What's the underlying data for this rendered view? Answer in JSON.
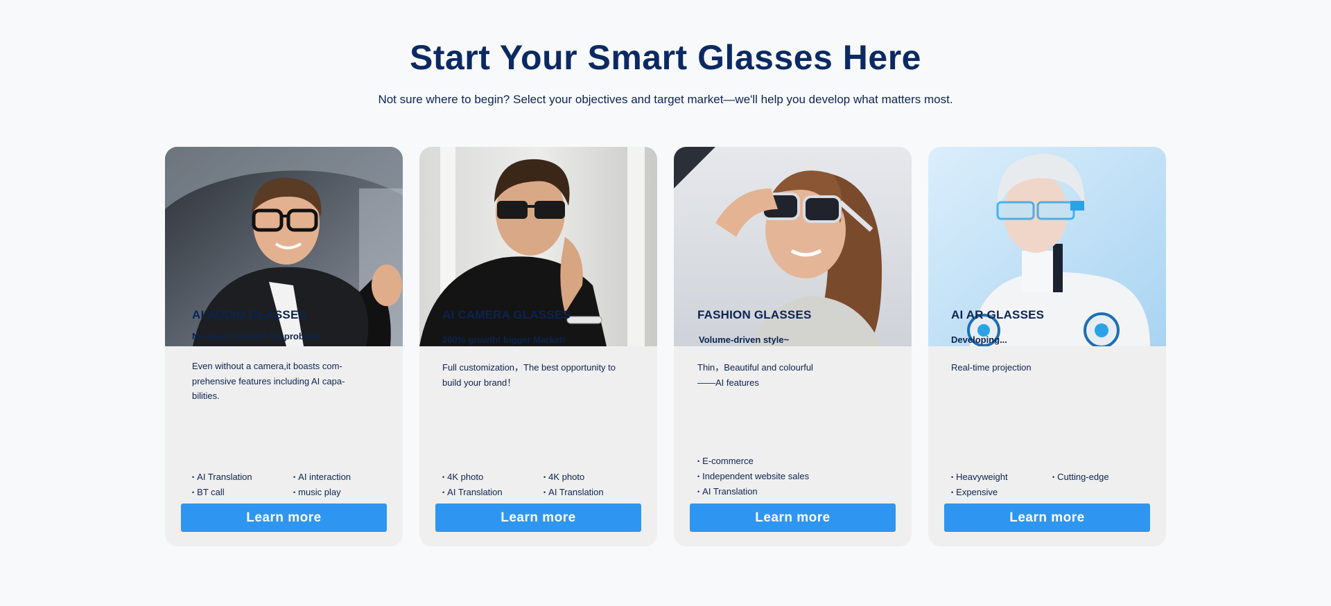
{
  "header": {
    "title": "Start Your Smart Glasses Here",
    "subtitle": "Not sure where to begin? Select your objectives and target market—we'll help you develop what matters most."
  },
  "cards": [
    {
      "title": "AI AUDIO GLASSES",
      "tagline": "No need camera? No problem.",
      "description": "Even without a camera,it boasts com-\nprehensive features including AI capa-\nbilities.",
      "features": [
        "AI Translation",
        "AI interaction",
        "BT call",
        "music play"
      ],
      "button": "Learn more",
      "image": "man-driving-car-wearing-glasses-photo"
    },
    {
      "title": "AI CAMERA GLASSES",
      "tagline": "200% growth! bigger Market!",
      "description": "Full customization，The best opportunity to\nbuild your brand！",
      "features": [
        "4K photo",
        "4K photo",
        "AI Translation",
        "AI Translation"
      ],
      "button": "Learn more",
      "image": "man-in-sunglasses-portrait-photo"
    },
    {
      "title": "FASHION GLASSES",
      "tagline": "Volume-driven style~",
      "description": "Thin，Beautiful and colourful\n——AI features",
      "features": [
        "E-commerce",
        "Independent website sales",
        "AI Translation"
      ],
      "button": "Learn more",
      "image": "woman-wearing-sunglasses-photo"
    },
    {
      "title": "AI AR GLASSES",
      "tagline": "Developing...",
      "description": "Real-time projection",
      "features": [
        "Heavyweight",
        "Cutting-edge",
        "Expensive"
      ],
      "button": "Learn more",
      "image": "robot-with-ar-glasses-illustration"
    }
  ],
  "colors": {
    "heading": "#0b2a63",
    "button": "#2e96f0",
    "card_bg": "#efefef",
    "page_bg": "#f8f9fa"
  }
}
